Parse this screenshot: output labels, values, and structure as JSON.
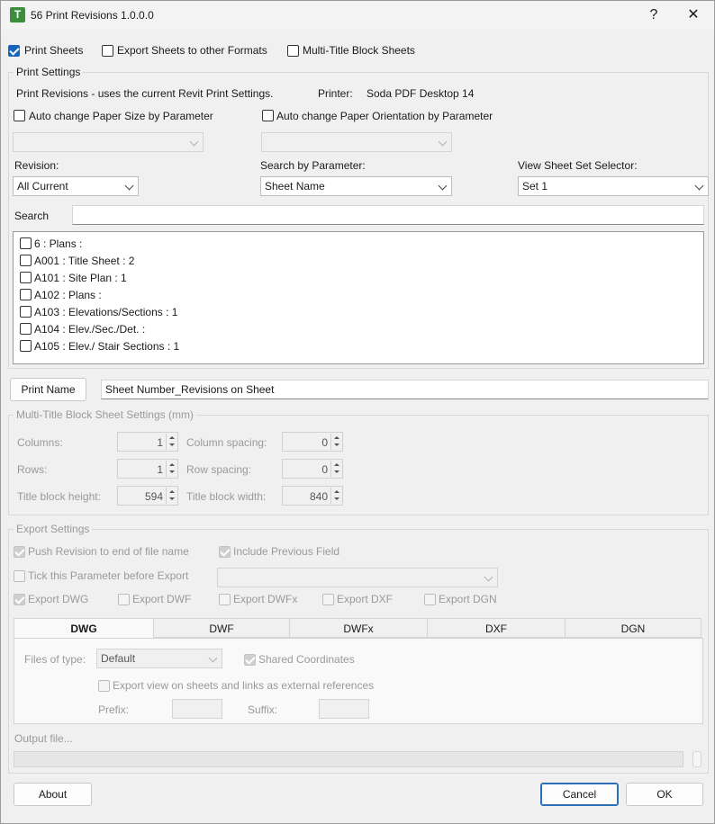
{
  "window": {
    "title": "56 Print Revisions 1.0.0.0",
    "icon_letter": "T",
    "help": "?",
    "close": "✕"
  },
  "top_options": [
    {
      "label": "Print Sheets",
      "checked": true
    },
    {
      "label": "Export Sheets to other Formats",
      "checked": false
    },
    {
      "label": "Multi-Title Block Sheets",
      "checked": false
    }
  ],
  "print_settings": {
    "legend": "Print Settings",
    "info": "Print Revisions - uses the current Revit Print Settings.",
    "printer_label": "Printer:",
    "printer_value": "Soda PDF Desktop 14",
    "auto_paper_size": "Auto change Paper Size by Parameter",
    "auto_orientation": "Auto change Paper Orientation by Parameter",
    "revision_label": "Revision:",
    "revision_value": "All Current",
    "search_param_label": "Search by Parameter:",
    "search_param_value": "Sheet Name",
    "view_set_label": "View Sheet Set Selector:",
    "view_set_value": "Set 1",
    "search_label": "Search",
    "search_value": ""
  },
  "sheets": [
    "6 : Plans :",
    "A001 : Title Sheet : 2",
    "A101 : Site Plan : 1",
    "A102 : Plans :",
    "A103 : Elevations/Sections : 1",
    "A104 : Elev./Sec./Det. :",
    "A105 : Elev./ Stair Sections : 1"
  ],
  "print_name": {
    "button": "Print Name",
    "value": "Sheet Number_Revisions on Sheet"
  },
  "multi_title": {
    "legend": "Multi-Title Block Sheet Settings (mm)",
    "columns_label": "Columns:",
    "columns_value": "1",
    "rows_label": "Rows:",
    "rows_value": "1",
    "tb_height_label": "Title block height:",
    "tb_height_value": "594",
    "col_spacing_label": "Column spacing:",
    "col_spacing_value": "0",
    "row_spacing_label": "Row spacing:",
    "row_spacing_value": "0",
    "tb_width_label": "Title block width:",
    "tb_width_value": "840"
  },
  "export_settings": {
    "legend": "Export Settings",
    "push_revision": "Push Revision to end of file name",
    "include_previous": "Include Previous Field",
    "tick_param": "Tick this Parameter before Export",
    "formats": [
      {
        "label": "Export DWG",
        "checked": true
      },
      {
        "label": "Export DWF",
        "checked": false
      },
      {
        "label": "Export DWFx",
        "checked": false
      },
      {
        "label": "Export DXF",
        "checked": false
      },
      {
        "label": "Export DGN",
        "checked": false
      }
    ],
    "tabs": [
      "DWG",
      "DWF",
      "DWFx",
      "DXF",
      "DGN"
    ],
    "files_type_label": "Files of type:",
    "files_type_value": "Default",
    "shared_coords": "Shared Coordinates",
    "export_xref": "Export view on sheets and links as external references",
    "prefix_label": "Prefix:",
    "suffix_label": "Suffix:",
    "output_file": "Output file..."
  },
  "footer": {
    "about": "About",
    "cancel": "Cancel",
    "ok": "OK"
  }
}
